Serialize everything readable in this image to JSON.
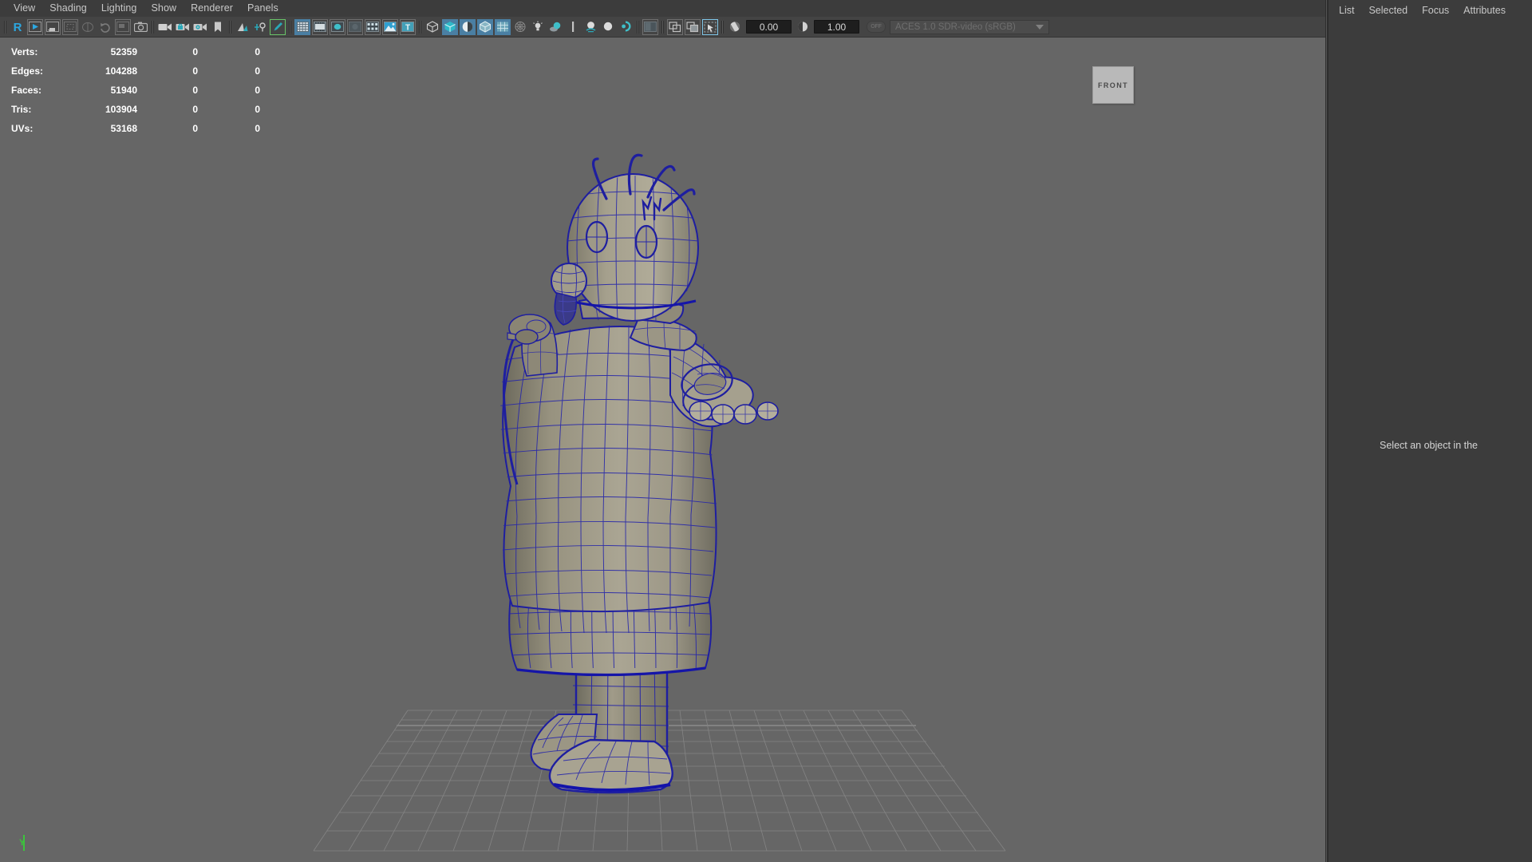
{
  "menubar": {
    "items": [
      {
        "label": "View"
      },
      {
        "label": "Shading"
      },
      {
        "label": "Lighting"
      },
      {
        "label": "Show"
      },
      {
        "label": "Renderer"
      },
      {
        "label": "Panels"
      }
    ]
  },
  "toolbar": {
    "exposure_value": "0.00",
    "gamma_value": "1.00",
    "color_management_profile": "ACES 1.0 SDR-video (sRGB)",
    "color_management_toggle": "OFF",
    "icons": [
      "render-view-icon",
      "render-sequence-icon",
      "ipr-render-icon",
      "render-region-icon",
      "render-settings-icon",
      "refresh-icon",
      "render-view-window-icon",
      "snapshot-icon",
      "camera-icon",
      "camera-lock-icon",
      "camera-attributes-icon",
      "bookmark-icon",
      "two-sided-lighting-icon",
      "shadows-icon",
      "edit-pencil-icon",
      "grid-icon",
      "film-gate-icon",
      "resolution-gate-icon",
      "gate-mask-icon",
      "film-origin-icon",
      "image-plane-icon",
      "text-overlay-icon",
      "wireframe-icon",
      "smooth-shade-icon",
      "shaded-wireframe-icon",
      "textured-icon",
      "hardware-texturing-icon",
      "lighting-icon",
      "use-all-lights-icon",
      "shadow-pass-icon",
      "ambient-occlusion-icon",
      "motion-blur-icon",
      "multisample-icon",
      "depth-of-field-icon",
      "isolate-select-icon",
      "xray-icon",
      "xray-joints-icon",
      "xray-active-components-icon",
      "exposure-icon",
      "gamma-icon"
    ]
  },
  "viewport": {
    "view_cube_label": "FRONT",
    "axis_label_y": "Y",
    "background_color": "#666666",
    "wireframe_color": "#2020a0",
    "surface_color": "#a8a493",
    "hud": {
      "columns": [
        "label",
        "total",
        "selected",
        "secondary"
      ],
      "rows": [
        {
          "label": "Verts:",
          "total": "52359",
          "selected": "0",
          "secondary": "0"
        },
        {
          "label": "Edges:",
          "total": "104288",
          "selected": "0",
          "secondary": "0"
        },
        {
          "label": "Faces:",
          "total": "51940",
          "selected": "0",
          "secondary": "0"
        },
        {
          "label": "Tris:",
          "total": "103904",
          "selected": "0",
          "secondary": "0"
        },
        {
          "label": "UVs:",
          "total": "53168",
          "selected": "0",
          "secondary": "0"
        }
      ]
    }
  },
  "right_panel": {
    "tabs": [
      {
        "label": "List"
      },
      {
        "label": "Selected"
      },
      {
        "label": "Focus"
      },
      {
        "label": "Attributes"
      }
    ],
    "message": "Select an object in the"
  }
}
